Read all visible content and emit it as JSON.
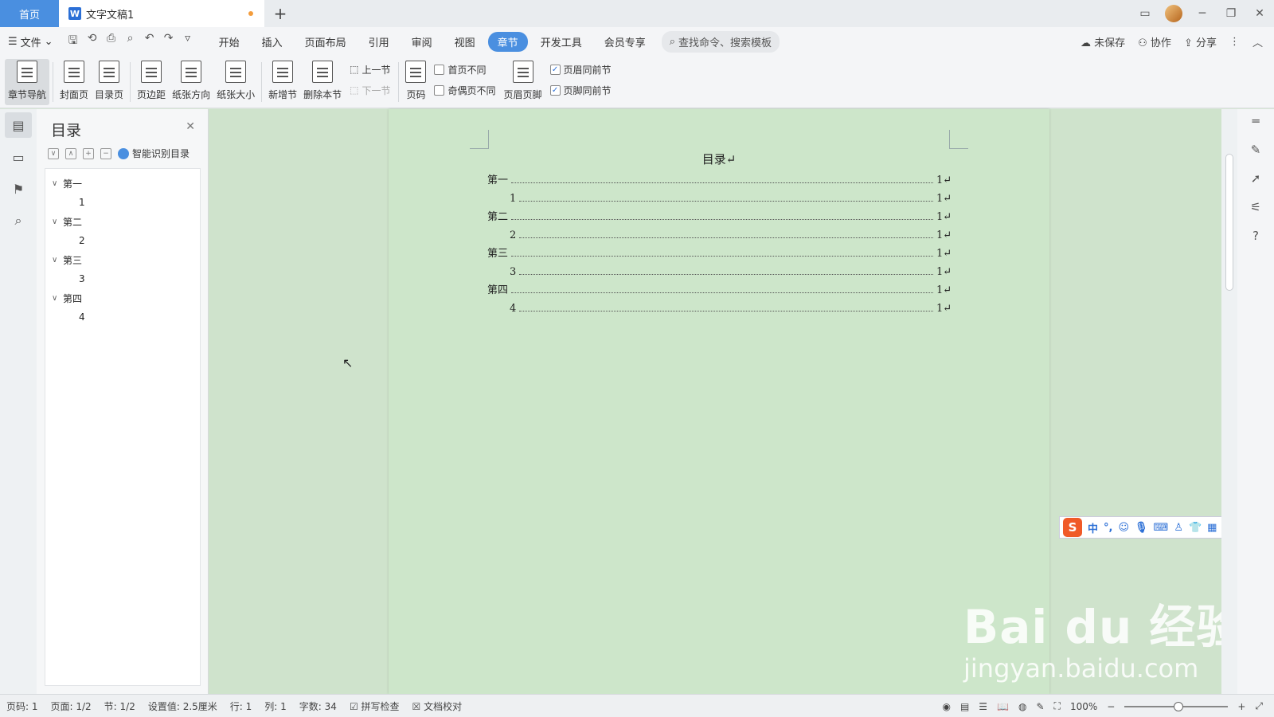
{
  "titlebar": {
    "home_tab": "首页",
    "doc_tab": "文字文稿1",
    "doc_icon": "W",
    "add_tab": "+"
  },
  "menubar": {
    "file": "文件",
    "items": [
      "开始",
      "插入",
      "页面布局",
      "引用",
      "审阅",
      "视图",
      "章节",
      "开发工具",
      "会员专享"
    ],
    "active": "章节",
    "search_placeholder": "查找命令、搜索模板",
    "unsaved": "未保存",
    "collab": "协作",
    "share": "分享"
  },
  "ribbon": {
    "chapter_nav": "章节导航",
    "cover": "封面页",
    "toc_page": "目录页",
    "margins": "页边距",
    "orientation": "纸张方向",
    "paper_size": "纸张大小",
    "new_section": "新增节",
    "delete_section": "删除本节",
    "prev_section": "上一节",
    "next_section": "下一节",
    "page_number": "页码",
    "first_page_diff": "首页不同",
    "odd_even_diff": "奇偶页不同",
    "header_footer": "页眉页脚",
    "header_same_prev": "页眉同前节",
    "footer_same_prev": "页脚同前节"
  },
  "toc_panel": {
    "title": "目录",
    "smart_detect": "智能识别目录",
    "items": [
      {
        "label": "第一",
        "child": "1"
      },
      {
        "label": "第二",
        "child": "2"
      },
      {
        "label": "第三",
        "child": "3"
      },
      {
        "label": "第四",
        "child": "4"
      }
    ]
  },
  "document": {
    "title": "目录↵",
    "lines": [
      {
        "text": "第一",
        "page": "1↵",
        "sub": false
      },
      {
        "text": "1",
        "page": "1↵",
        "sub": true
      },
      {
        "text": "第二",
        "page": "1↵",
        "sub": false
      },
      {
        "text": "2",
        "page": "1↵",
        "sub": true
      },
      {
        "text": "第三",
        "page": "1↵",
        "sub": false
      },
      {
        "text": "3",
        "page": "1↵",
        "sub": true
      },
      {
        "text": "第四",
        "page": "1↵",
        "sub": false
      },
      {
        "text": "4",
        "page": "1↵",
        "sub": true
      }
    ]
  },
  "ime": {
    "logo": "S",
    "lang": "中"
  },
  "watermark": {
    "brand": "Bai du 经验",
    "url": "jingyan.baidu.com"
  },
  "statusbar": {
    "page_no": "页码: 1",
    "pages": "页面: 1/2",
    "section": "节: 1/2",
    "setting": "设置值: 2.5厘米",
    "row": "行: 1",
    "col": "列: 1",
    "word_count": "字数: 34",
    "spell_check": "拼写检查",
    "doc_proof": "文档校对",
    "zoom": "100%"
  },
  "colors": {
    "accent": "#4a8fe0",
    "page_bg": "#cde6ca",
    "workspace_bg": "#cfe3cc"
  }
}
